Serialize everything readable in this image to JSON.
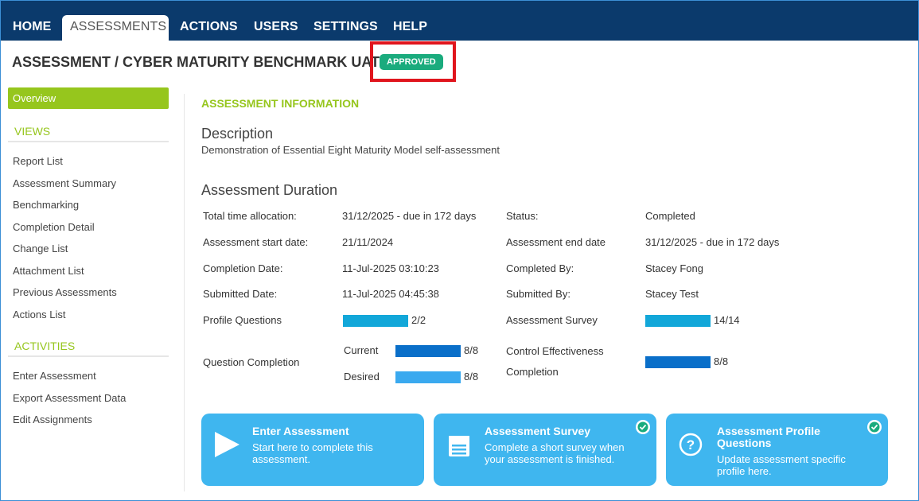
{
  "nav": {
    "items": [
      {
        "label": "HOME"
      },
      {
        "label": "ASSESSMENTS",
        "active": true
      },
      {
        "label": "ACTIONS"
      },
      {
        "label": "USERS"
      },
      {
        "label": "SETTINGS"
      },
      {
        "label": "HELP"
      }
    ]
  },
  "header": {
    "title": "ASSESSMENT / CYBER MATURITY BENCHMARK UAT",
    "status_badge": "APPROVED"
  },
  "sidebar": {
    "overview": "Overview",
    "views_heading": "VIEWS",
    "views": [
      "Report List",
      "Assessment Summary",
      "Benchmarking",
      "Completion Detail",
      "Change List",
      "Attachment List",
      "Previous Assessments",
      "Actions List"
    ],
    "activities_heading": "ACTIVITIES",
    "activities": [
      "Enter Assessment",
      "Export Assessment Data",
      "Edit Assignments"
    ]
  },
  "main": {
    "section_heading": "ASSESSMENT INFORMATION",
    "description_title": "Description",
    "description_text": "Demonstration of Essential Eight Maturity Model self-assessment",
    "duration_title": "Assessment Duration",
    "fields": {
      "total_time_label": "Total time allocation:",
      "total_time_value": "31/12/2025 - due in 172 days",
      "status_label": "Status:",
      "status_value": "Completed",
      "start_date_label": "Assessment start date:",
      "start_date_value": "21/11/2024",
      "end_date_label": "Assessment end date",
      "end_date_value": "31/12/2025 - due in 172 days",
      "completion_date_label": "Completion Date:",
      "completion_date_value": "11-Jul-2025 03:10:23",
      "completed_by_label": "Completed By:",
      "completed_by_value": "Stacey Fong",
      "submitted_date_label": "Submitted Date:",
      "submitted_date_value": "11-Jul-2025 04:45:38",
      "submitted_by_label": "Submitted By:",
      "submitted_by_value": "Stacey Test"
    },
    "progress": {
      "profile_questions_label": "Profile Questions",
      "profile_questions_value": "2/2",
      "profile_questions_fraction": 1.0,
      "assessment_survey_label": "Assessment Survey",
      "assessment_survey_value": "14/14",
      "assessment_survey_fraction": 1.0,
      "question_completion_label": "Question Completion",
      "current_label": "Current",
      "current_value": "8/8",
      "current_fraction": 1.0,
      "desired_label": "Desired",
      "desired_value": "8/8",
      "desired_fraction": 1.0,
      "control_effectiveness_label_1": "Control Effectiveness",
      "control_effectiveness_label_2": "Completion",
      "control_effectiveness_value": "8/8",
      "control_effectiveness_fraction": 1.0
    },
    "cards": [
      {
        "title": "Enter Assessment",
        "desc": "Start here to complete this assessment.",
        "icon": "play-icon",
        "checked": false
      },
      {
        "title": "Assessment Survey",
        "desc": "Complete a short survey when your assessment is finished.",
        "icon": "survey-icon",
        "checked": true
      },
      {
        "title": "Assessment Profile Questions",
        "desc": "Update assessment specific profile here.",
        "icon": "question-icon",
        "checked": true
      }
    ]
  },
  "colors": {
    "nav_bg": "#0b3a6c",
    "accent_green": "#96c61d",
    "badge_green": "#1aab7d",
    "card_blue": "#3fb6ef",
    "bar_cyan": "#12a7d9",
    "bar_dark_blue": "#0a6fc9",
    "bar_light_blue": "#3aa9ef",
    "highlight_red": "#e0151d"
  }
}
